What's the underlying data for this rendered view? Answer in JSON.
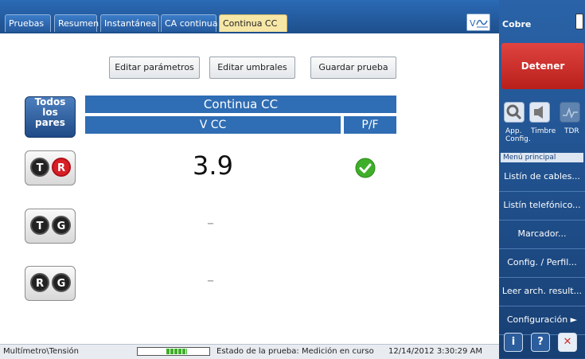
{
  "tabs": [
    "Pruebas",
    "Resumen",
    "Instantánea",
    "CA continua",
    "Continua CC"
  ],
  "active_tab": "Continua CC",
  "buttons": {
    "edit_params": "Editar parámetros",
    "edit_thresholds": "Editar umbrales",
    "save_test": "Guardar prueba"
  },
  "all_pairs_label": [
    "Todos",
    "los",
    "pares"
  ],
  "table": {
    "title": "Continua CC",
    "col_value": "V CC",
    "col_pf": "P/F"
  },
  "rows": [
    {
      "pair": [
        "T",
        "R"
      ],
      "value": "3.9",
      "pf": "pass"
    },
    {
      "pair": [
        "T",
        "G"
      ],
      "value": "–"
    },
    {
      "pair": [
        "R",
        "G"
      ],
      "value": "–"
    }
  ],
  "status_bar": {
    "path": "Multímetro\\Tensión",
    "state": "Estado de la prueba: Medición en curso",
    "datetime": "12/14/2012 3:30:29 AM"
  },
  "right_panel": {
    "title": "Cobre",
    "stop": "Detener",
    "icon_labels": [
      "App. Config.",
      "Timbre",
      "TDR"
    ],
    "menu_header": "Menú principal",
    "menu": [
      "Listín de cables...",
      "Listín telefónico...",
      "Marcador...",
      "Config. / Perfil...",
      "Leer arch. result...",
      "Configuración ►"
    ]
  },
  "colors": {
    "accent": "#2f6db4",
    "stop": "#d0302c",
    "active_tab": "#f7e7a6",
    "pass": "#3fae2a"
  }
}
